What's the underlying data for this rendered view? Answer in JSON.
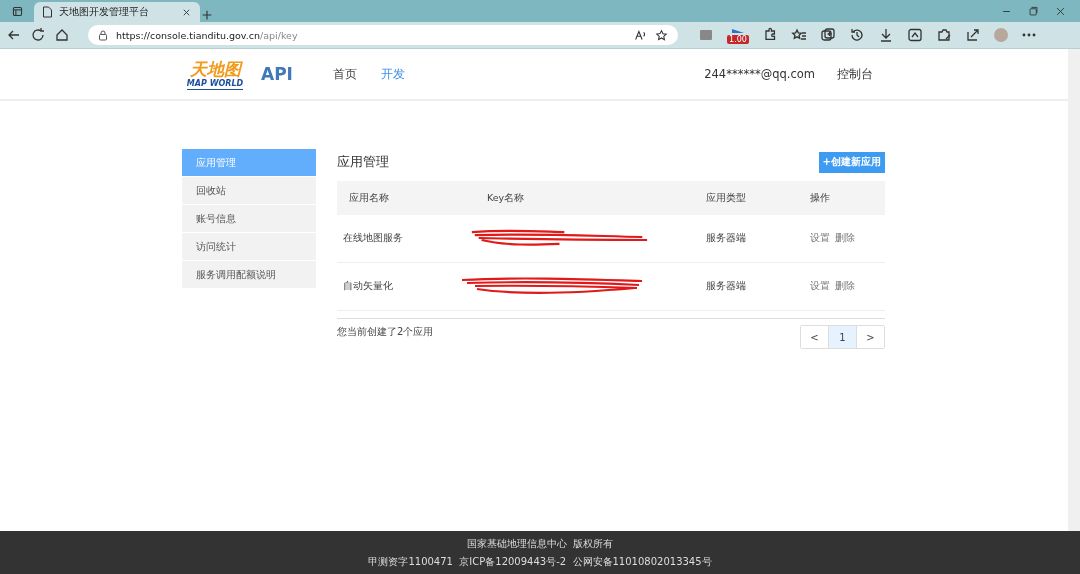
{
  "browser": {
    "tab_title": "天地图开发管理平台",
    "url_host": "https://console.tianditu.gov.cn",
    "url_path": "/api/key",
    "toolbar_badge": "1.00"
  },
  "header": {
    "logo_cn": "天地图",
    "logo_en": "MAP WORLD",
    "logo_api": "API",
    "nav": [
      {
        "label": "首页",
        "selected": false
      },
      {
        "label": "开发",
        "selected": true
      }
    ],
    "user": "244******@qq.com",
    "console": "控制台"
  },
  "sidebar": {
    "items": [
      {
        "label": "应用管理",
        "selected": true
      },
      {
        "label": "回收站",
        "selected": false
      },
      {
        "label": "账号信息",
        "selected": false
      },
      {
        "label": "访问统计",
        "selected": false
      },
      {
        "label": "服务调用配额说明",
        "selected": false
      }
    ]
  },
  "main": {
    "title": "应用管理",
    "create_button": "+创建新应用",
    "table": {
      "columns": [
        "应用名称",
        "Key名称",
        "应用类型",
        "操作"
      ],
      "rows": [
        {
          "name": "在线地图服务",
          "type": "服务器端",
          "actions": [
            "设置",
            "删除"
          ]
        },
        {
          "name": "自动矢量化",
          "type": "服务器端",
          "actions": [
            "设置",
            "删除"
          ]
        }
      ]
    },
    "summary": "您当前创建了2个应用",
    "pagination": [
      {
        "label": "<",
        "selected": false
      },
      {
        "label": "1",
        "selected": true
      },
      {
        "label": ">",
        "selected": false
      }
    ]
  },
  "footer": {
    "lines": [
      "国家基础地理信息中心  版权所有",
      "甲测资字1100471  京ICP备12009443号-2  公网安备11010802013345号"
    ]
  }
}
